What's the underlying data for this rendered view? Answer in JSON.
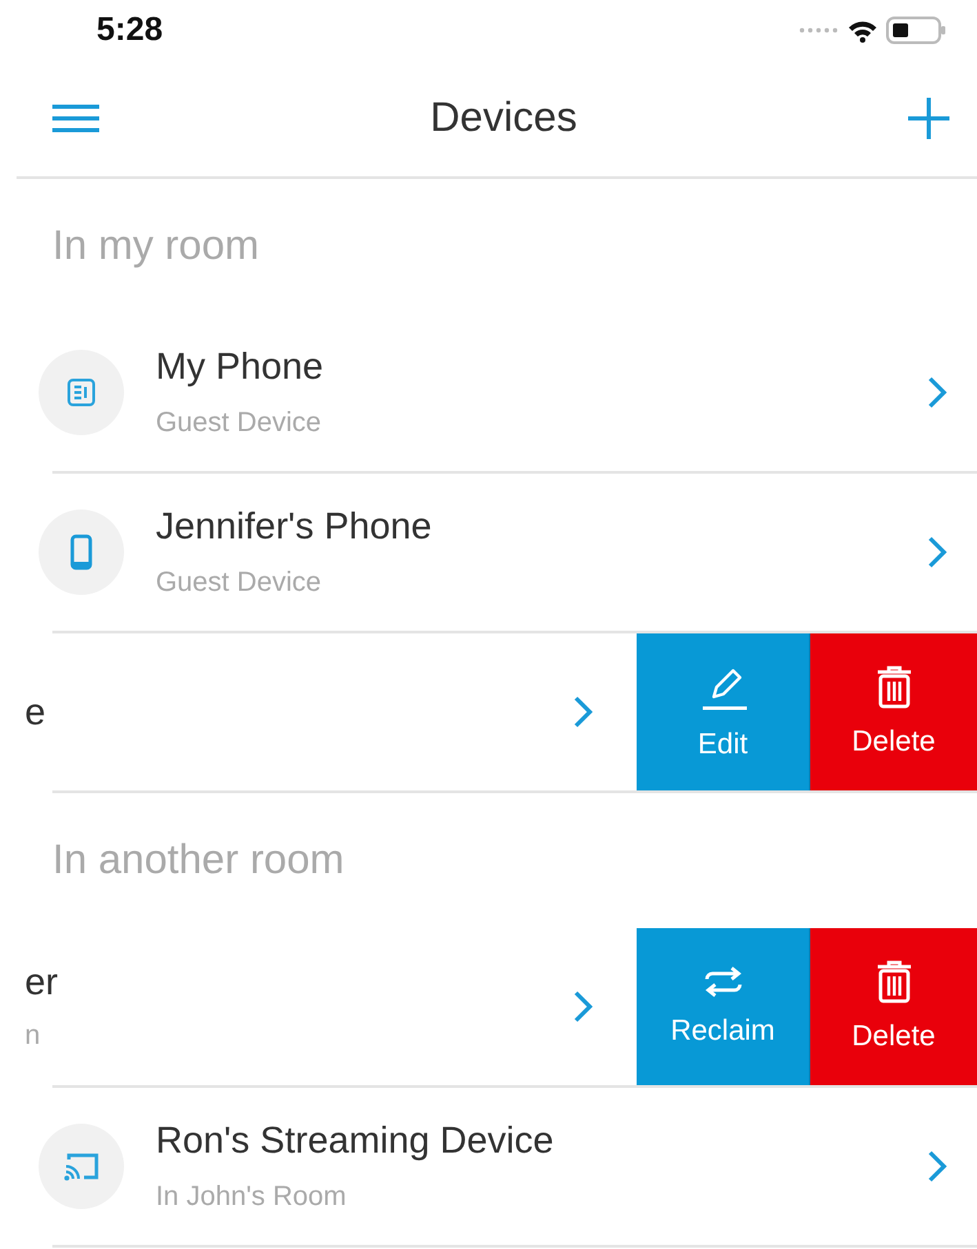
{
  "status_bar": {
    "time": "5:28"
  },
  "nav": {
    "title": "Devices"
  },
  "sections": [
    {
      "header": "In my room",
      "rows": [
        {
          "kind": "tablet",
          "title": "My Phone",
          "subtitle": "Guest Device"
        },
        {
          "kind": "phone",
          "title": "Jennifer's Phone",
          "subtitle": "Guest Device"
        },
        {
          "kind": "swiped",
          "title": "e",
          "actions": [
            {
              "kind": "edit",
              "label": "Edit"
            },
            {
              "kind": "delete",
              "label": "Delete"
            }
          ]
        }
      ]
    },
    {
      "header": "In another room",
      "rows": [
        {
          "kind": "swiped",
          "title": "er",
          "subtitle": "n",
          "actions": [
            {
              "kind": "reclaim",
              "label": "Reclaim"
            },
            {
              "kind": "delete",
              "label": "Delete"
            }
          ]
        },
        {
          "kind": "cast",
          "title": "Ron's Streaming Device",
          "subtitle": "In John's Room"
        }
      ]
    }
  ]
}
